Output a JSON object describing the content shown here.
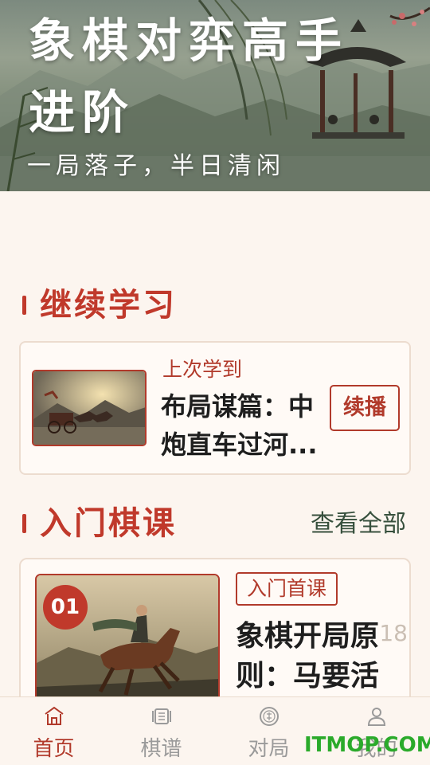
{
  "hero": {
    "title": "象棋对弈高手进阶",
    "subtitle": "一局落子，半日清闲"
  },
  "continue_section": {
    "title": "继续学习",
    "label": "上次学到",
    "lesson": "布局谋篇：中炮直车过河...",
    "resume_label": "续播"
  },
  "intro_section": {
    "title": "入门棋课",
    "see_all": "查看全部"
  },
  "course": {
    "number": "01",
    "tag": "入门首课",
    "title": "象棋开局原则：马要活",
    "count": "18"
  },
  "tabs": [
    {
      "label": "首页",
      "icon": "home-icon",
      "active": true
    },
    {
      "label": "棋谱",
      "icon": "scroll-icon",
      "active": false
    },
    {
      "label": "对局",
      "icon": "chess-piece-icon",
      "active": false
    },
    {
      "label": "我的",
      "icon": "user-icon",
      "active": false
    }
  ],
  "watermark": "ITMOP.COM",
  "colors": {
    "accent": "#c0392b",
    "background": "#fcf5ef",
    "link": "#37503d",
    "inactive": "#9a9a9a"
  }
}
